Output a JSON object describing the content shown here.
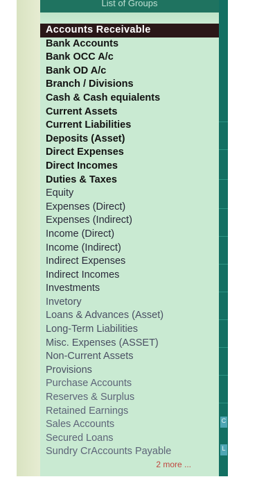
{
  "panel": {
    "title": "List of Groups",
    "selected_index": 0,
    "items": [
      "Accounts Receivable",
      "Bank Accounts",
      "Bank OCC A/c",
      "Bank OD A/c",
      "Branch / Divisions",
      "Cash & Cash equialents",
      "Current Assets",
      "Current Liabilities",
      "Deposits (Asset)",
      "Direct Expenses",
      "Direct Incomes",
      "Duties & Taxes",
      "Equity",
      "Expenses (Direct)",
      "Expenses (Indirect)",
      "Income (Direct)",
      "Income (Indirect)",
      "Indirect Expenses",
      "Indirect Incomes",
      "Investments",
      "Invetory",
      "Loans & Advances (Asset)",
      "Long-Term Liabilities",
      "Misc. Expenses (ASSET)",
      "Non-Current Assets",
      "Provisions",
      "Purchase Accounts",
      "Reserves & Surplus",
      "Retained Earnings",
      "Sales Accounts",
      "Secured Loans",
      "Sundry CrAccounts Payable"
    ],
    "more_label": "2 more ..."
  },
  "side_tabs": [
    "C",
    "L"
  ],
  "colors": {
    "panel_bg": "#c9ead2",
    "selected_bg": "#2a1718",
    "header_bg": "#1f7360",
    "more_text": "#c0463f"
  }
}
